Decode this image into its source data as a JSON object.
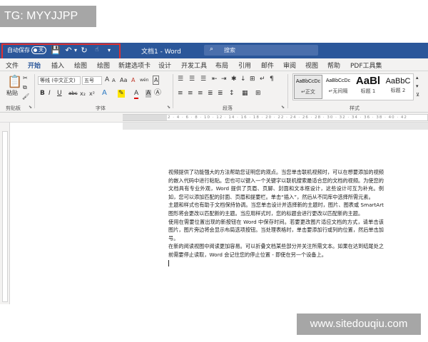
{
  "watermarks": {
    "top": "TG: MYYJJPP",
    "bottom": "www.sitedouqiu.com"
  },
  "titlebar": {
    "autosave_label": "自动保存",
    "autosave_state": "关",
    "save_icon": "💾",
    "undo_icon": "↶",
    "undo_more": "▾",
    "redo_icon": "↻",
    "touch_icon": "☝",
    "customize_icon": "▾",
    "doc_title": "文档1 - Word",
    "search_placeholder": "搜索",
    "search_icon": "⌕",
    "accent_color": "#2b579a"
  },
  "tabs": [
    "文件",
    "开始",
    "插入",
    "绘图",
    "绘图",
    "新建选项卡",
    "设计",
    "开发工具",
    "布局",
    "引用",
    "邮件",
    "审阅",
    "视图",
    "帮助",
    "PDF工具集"
  ],
  "active_tab": "开始",
  "ribbon": {
    "clipboard": {
      "paste": "粘贴",
      "label": "剪贴板",
      "cut_icon": "✂",
      "copy_icon": "⧉",
      "painter_icon": "🖌"
    },
    "font": {
      "label": "字体",
      "font_name": "等线 (中文正文)",
      "font_size": "五号",
      "grow": "A",
      "shrink": "A",
      "case": "Aa",
      "clear": "A",
      "phonetic": "wén",
      "border_char": "A",
      "bold": "B",
      "italic": "I",
      "underline": "U",
      "strike": "abc",
      "subscript": "x₂",
      "superscript": "x²",
      "effects": "A",
      "highlight": "✎",
      "font_color": "A",
      "shade": "A",
      "enclose": "Ⓐ"
    },
    "paragraph": {
      "label": "段落",
      "row1": [
        "☰",
        "☰",
        "☰",
        "⇤",
        "⇥",
        "✱",
        "↓",
        "⊞",
        "↵",
        "¶"
      ],
      "row2": [
        "≡",
        "≡",
        "≡",
        "≣",
        "≣",
        "↕",
        "▦",
        "⊞"
      ]
    },
    "styles": {
      "label": "样式",
      "items": [
        {
          "sample": "AaBbCcDc",
          "name": "↵正文"
        },
        {
          "sample": "AaBbCcDc",
          "name": "↵无间隔"
        },
        {
          "sample": "AaBl",
          "name": "标题 1"
        },
        {
          "sample": "AaBbC",
          "name": "标题 2"
        }
      ]
    }
  },
  "ruler_ticks": "8 · 6 · 4 · 2 · · · 2 · 4 · 6 · 8 · 10 · 12 · 14 · 16 · 18 · 20 · 22 · 24 · 26 · 28 · 30 · 32 · 34 · 36 · 38 · 40 · 42",
  "document": {
    "paragraphs": [
      "视频提供了功能强大的方法帮助您证明您的观点。当您单击联机视频时，可以在想要添加的视频的嵌入代码中进行粘贴。您也可以键入一个关键字以联机搜索最适合您的文档的视频。为使您的文档具有专业外观，Word 提供了页眉、页脚、封面和文本框设计，这些设计可互为补充。例如，您可以添加匹配的封面、页眉和提要栏。单击“插入”，然后从不同库中选择所需元素。",
      "主题和样式也有助于文档保持协调。当您单击设计并选择新的主题时，图片、图表或 SmartArt 图形将会更改以匹配新的主题。当应用样式时，您的标题会进行更改以匹配新的主题。",
      "使用在需要位置出现的新按钮在 Word 中保存时间。若要更改图片适应文档的方式，请单击该图片，图片旁边将会显示布局选项按钮。当处理表格时，单击要添加行或列的位置，然后单击加号。",
      "在新的阅读视图中阅读更加容易。可以折叠文档某些部分并关注所需文本。如果在达到结尾处之前需要停止读取，Word 会记住您的停止位置 - 即使在另一个设备上。"
    ]
  }
}
